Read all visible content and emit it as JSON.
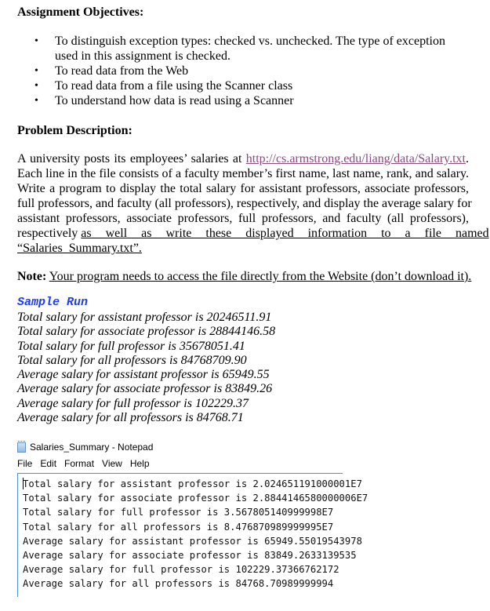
{
  "objectives": {
    "heading": "Assignment Objectives:",
    "items": [
      "To distinguish exception types: checked vs. unchecked. The type of exception",
      "used in this assignment is checked.",
      "To read data from the Web",
      "To read data from a file using the Scanner class",
      "To understand how data is read using a Scanner"
    ],
    "bullet": "•"
  },
  "problem": {
    "heading": "Problem Description:",
    "line1_pre": "A university posts its employees’ salaries at ",
    "link": "http://cs.armstrong.edu/liang/data/Salary.txt",
    "line1_post": ".",
    "line2": "Each line in the file consists of a faculty member’s first name, last name, rank, and salary.",
    "line3": "Write a program to display the total salary for assistant professors, associate professors,",
    "line4": "full professors, and faculty (all professors), respectively, and display the average salary for",
    "line5": "assistant professors, associate professors, full professors, and faculty (all professors),",
    "line6_pre": "respectively ",
    "line6_ul": "as well as write these displayed information to a file named",
    "line7_ul": "“Salaries_Summary.txt”."
  },
  "note": {
    "label": "Note:",
    "text": "Your program needs to access the file directly from the Website (don’t download it)."
  },
  "sample_run": {
    "title": "Sample Run",
    "lines": [
      "Total salary for assistant professor is 20246511.91",
      "Total salary for associate professor is 28844146.58",
      "Total salary for full professor is 35678051.41",
      "Total salary for all professors is 84768709.90",
      "Average salary for assistant professor is 65949.55",
      "Average salary for associate professor is 83849.26",
      "Average salary for full professor is 102229.37",
      "Average salary for all professors is 84768.71"
    ]
  },
  "notepad": {
    "title": "Salaries_Summary - Notepad",
    "icon": "notepad-icon",
    "menu": [
      "File",
      "Edit",
      "Format",
      "View",
      "Help"
    ],
    "lines": [
      "Total salary for assistant professor is 2.024651191000001E7",
      "Total salary for associate professor is 2.8844146580000006E7",
      "Total salary for full professor is 3.567805140999998E7",
      "Total salary for all professors is 8.476870989999995E7",
      "Average salary for assistant professor is 65949.55019543978",
      "Average salary for associate professor is 83849.2633139535",
      "Average salary for full professor is 102229.37366762172",
      "Average salary for all professors is 84768.70989999994"
    ]
  },
  "colors": {
    "link": "#8a4a7e",
    "sample_title": "#1f3cf5",
    "notepad_border": "#4a90d9"
  }
}
